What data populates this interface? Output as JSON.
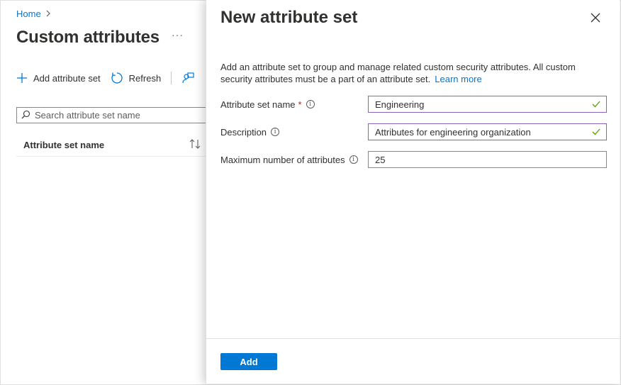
{
  "breadcrumb": {
    "home_label": "Home"
  },
  "page": {
    "title": "Custom attributes",
    "more_label": "···"
  },
  "toolbar": {
    "add_label": "Add attribute set",
    "refresh_label": "Refresh"
  },
  "search": {
    "placeholder": "Search attribute set name"
  },
  "table": {
    "columns": [
      "Attribute set name"
    ]
  },
  "panel": {
    "title": "New attribute set",
    "description": "Add an attribute set to group and manage related custom security attributes. All custom security attributes must be a part of an attribute set.",
    "learn_more_label": "Learn more",
    "fields": {
      "name": {
        "label": "Attribute set name",
        "required_mark": "*",
        "value": "Engineering"
      },
      "description": {
        "label": "Description",
        "value": "Attributes for engineering organization"
      },
      "max_attributes": {
        "label": "Maximum number of attributes",
        "value": "25"
      }
    },
    "add_button_label": "Add"
  },
  "icons": {
    "chevron": "chevron-right-icon",
    "more": "more-icon",
    "add": "plus-icon",
    "refresh": "refresh-icon",
    "feedback": "feedback-icon",
    "search": "search-icon",
    "sort": "sort-icon",
    "close": "close-icon",
    "info": "info-icon",
    "check": "check-icon"
  },
  "colors": {
    "accent": "#0078d4",
    "valid_border": "#8764b8",
    "check": "#57a300",
    "required": "#a4262c"
  }
}
